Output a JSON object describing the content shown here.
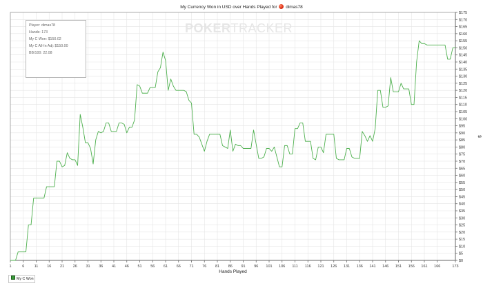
{
  "title_prefix": "My Currency Won in USD over Hands Played for",
  "title_player": "dimas78",
  "watermark": {
    "bold": "POKER",
    "thin": "TRACKER"
  },
  "info_box": [
    "Player: dimas78",
    "Hands: 173",
    "My C Won: $150.02",
    "My C All-In Adj: $150.00",
    "BB/100: 22.08"
  ],
  "legend": {
    "label": "My C Won"
  },
  "colors": {
    "line": "#4caf4c",
    "grid": "#e4e4e4",
    "axis": "#666666"
  },
  "chart_data": {
    "type": "line",
    "xlabel": "Hands Played",
    "ylabel": "$",
    "xlim": [
      1,
      173
    ],
    "ylim": [
      0,
      175
    ],
    "x_ticks": [
      1,
      6,
      11,
      16,
      21,
      26,
      31,
      36,
      41,
      46,
      51,
      56,
      61,
      66,
      71,
      76,
      81,
      86,
      91,
      96,
      101,
      106,
      111,
      116,
      121,
      126,
      131,
      136,
      141,
      146,
      151,
      156,
      161,
      166,
      173
    ],
    "y_ticks": [
      0,
      5,
      10,
      15,
      20,
      25,
      30,
      35,
      40,
      45,
      50,
      55,
      60,
      65,
      70,
      75,
      80,
      85,
      90,
      95,
      100,
      105,
      110,
      115,
      120,
      125,
      130,
      135,
      140,
      145,
      150,
      155,
      160,
      165,
      170,
      175
    ],
    "y_tick_prefix": "$",
    "grid": true,
    "legend_position": "bottom-left",
    "series": [
      {
        "name": "My C Won",
        "x": [
          1,
          2,
          3,
          4,
          5,
          6,
          7,
          8,
          9,
          10,
          11,
          12,
          13,
          14,
          15,
          16,
          17,
          18,
          19,
          20,
          21,
          22,
          23,
          24,
          25,
          26,
          27,
          28,
          29,
          30,
          31,
          32,
          33,
          34,
          35,
          36,
          37,
          38,
          39,
          40,
          41,
          42,
          43,
          44,
          45,
          46,
          47,
          48,
          49,
          50,
          51,
          52,
          53,
          54,
          55,
          56,
          57,
          58,
          59,
          60,
          61,
          62,
          63,
          64,
          65,
          66,
          67,
          68,
          69,
          70,
          71,
          72,
          73,
          74,
          75,
          76,
          77,
          78,
          79,
          80,
          81,
          82,
          83,
          84,
          85,
          86,
          87,
          88,
          89,
          90,
          91,
          92,
          93,
          94,
          95,
          96,
          97,
          98,
          99,
          100,
          101,
          102,
          103,
          104,
          105,
          106,
          107,
          108,
          109,
          110,
          111,
          112,
          113,
          114,
          115,
          116,
          117,
          118,
          119,
          120,
          121,
          122,
          123,
          124,
          125,
          126,
          127,
          128,
          129,
          130,
          131,
          132,
          133,
          134,
          135,
          136,
          137,
          138,
          139,
          140,
          141,
          142,
          143,
          144,
          145,
          146,
          147,
          148,
          149,
          150,
          151,
          152,
          153,
          154,
          155,
          156,
          157,
          158,
          159,
          160,
          161,
          162,
          163,
          164,
          165,
          166,
          167,
          168,
          169,
          170,
          171,
          172,
          173
        ],
        "y": [
          0,
          0,
          0,
          6,
          6,
          6,
          6,
          25,
          25,
          44,
          44,
          44,
          44,
          44,
          52,
          52,
          52,
          52,
          70,
          70,
          66,
          67,
          76,
          72,
          71,
          71,
          67,
          103,
          94,
          83,
          83,
          79,
          68,
          85,
          91,
          90,
          91,
          97,
          97,
          91,
          91,
          91,
          97,
          97,
          96,
          90,
          94,
          94,
          99,
          124,
          123,
          118,
          118,
          118,
          122,
          122,
          122,
          133,
          136,
          147,
          141,
          120,
          128,
          123,
          120,
          120,
          120,
          120,
          119,
          113,
          111,
          89,
          89,
          87,
          82,
          77,
          84,
          89,
          89,
          89,
          89,
          89,
          81,
          80,
          79,
          92,
          77,
          82,
          81,
          81,
          79,
          79,
          79,
          79,
          92,
          82,
          72,
          72,
          73,
          79,
          79,
          77,
          80,
          73,
          66,
          66,
          81,
          81,
          75,
          75,
          93,
          93,
          97,
          97,
          84,
          84,
          84,
          72,
          71,
          80,
          80,
          76,
          89,
          89,
          89,
          89,
          72,
          71,
          71,
          71,
          79,
          79,
          73,
          72,
          72,
          72,
          91,
          88,
          84,
          88,
          84,
          93,
          120,
          120,
          108,
          108,
          109,
          129,
          119,
          119,
          119,
          125,
          121,
          121,
          121,
          110,
          110,
          140,
          155,
          153,
          153,
          152,
          152,
          152,
          152,
          152,
          152,
          152,
          152,
          142,
          142,
          150,
          150
        ]
      }
    ]
  }
}
